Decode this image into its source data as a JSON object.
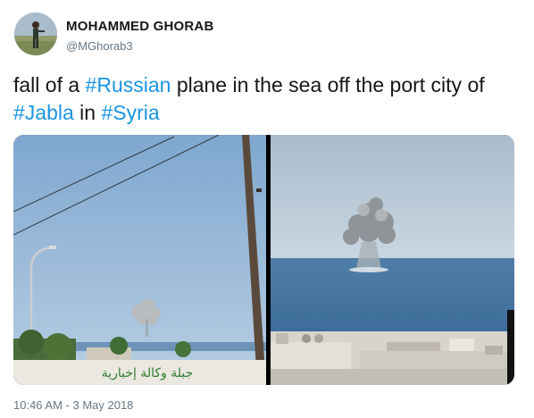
{
  "author": {
    "name": "MOHAMMED GHORAB",
    "handle": "@MGhorab3",
    "avatar_icon": "profile-photo-icon"
  },
  "tweet": {
    "text_parts": [
      {
        "text": "fall of a ",
        "hashtag": false
      },
      {
        "text": "#Russian",
        "hashtag": true
      },
      {
        "text": " plane in the sea off the port city of ",
        "hashtag": false
      },
      {
        "text": "#Jabla",
        "hashtag": true
      },
      {
        "text": " in ",
        "hashtag": false
      },
      {
        "text": "#Syria",
        "hashtag": true
      }
    ],
    "timestamp": "10:46 AM - 3 May 2018"
  },
  "media": {
    "count": 2,
    "left_photo": {
      "icon": "explosion-smoke-photo",
      "sign_text": "جبلة وكالة إخبارية"
    },
    "right_photo": {
      "icon": "explosion-over-sea-photo"
    }
  },
  "colors": {
    "text": "#14171a",
    "secondary": "#657786",
    "hashtag": "#1b95e0"
  }
}
